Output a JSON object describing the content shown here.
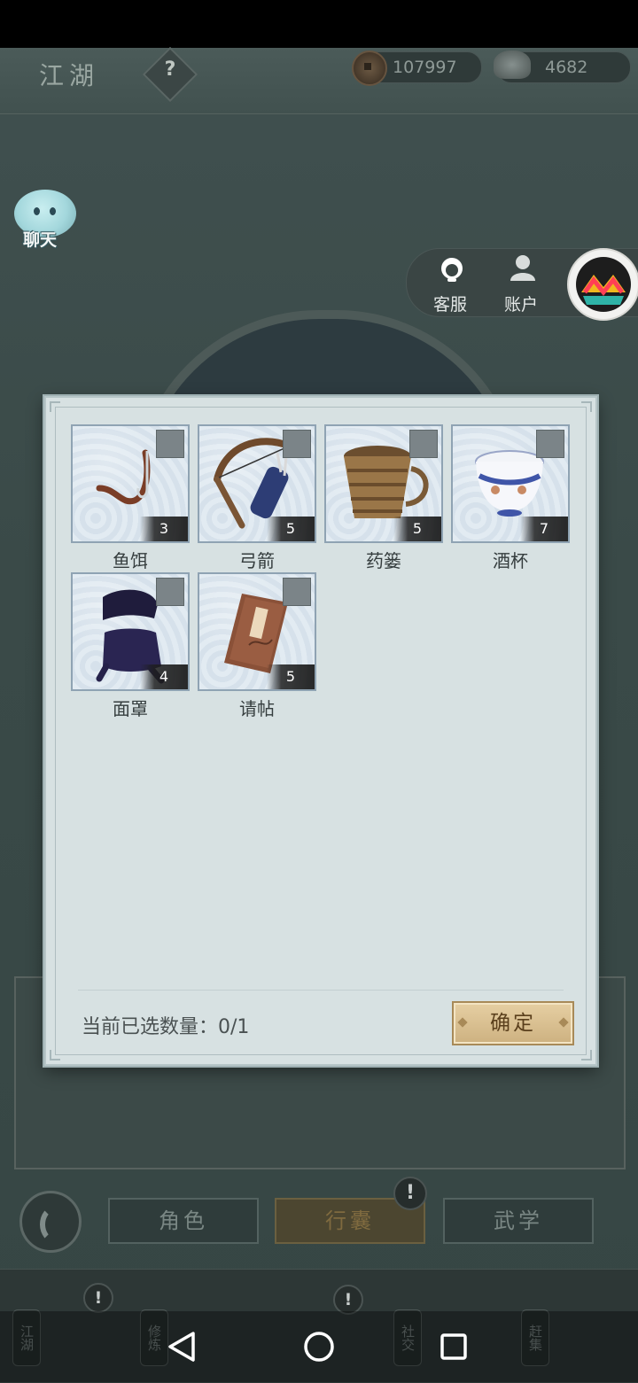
{
  "header": {
    "title": "江湖",
    "help_symbol": "?",
    "coins": "107997",
    "silver": "4682"
  },
  "chat": {
    "label": "聊天"
  },
  "service_panel": {
    "customer_service": "客服",
    "account": "账户"
  },
  "dialog": {
    "items": [
      {
        "name": "鱼饵",
        "count": "3",
        "icon": "bait-icon"
      },
      {
        "name": "弓箭",
        "count": "5",
        "icon": "bow-arrows-icon"
      },
      {
        "name": "药篓",
        "count": "5",
        "icon": "herb-basket-icon"
      },
      {
        "name": "酒杯",
        "count": "7",
        "icon": "wine-cup-icon"
      },
      {
        "name": "面罩",
        "count": "4",
        "icon": "mask-icon"
      },
      {
        "name": "请帖",
        "count": "5",
        "icon": "invitation-icon"
      }
    ],
    "selected_label": "当前已选数量：0/1",
    "confirm_label": "确定"
  },
  "tabs": {
    "role": "角色",
    "bag": "行囊",
    "martial": "武学",
    "alert": "!"
  },
  "bottom_nav": {
    "tags": [
      "江湖",
      "修炼",
      "社交",
      "赶集"
    ],
    "alert": "!"
  }
}
